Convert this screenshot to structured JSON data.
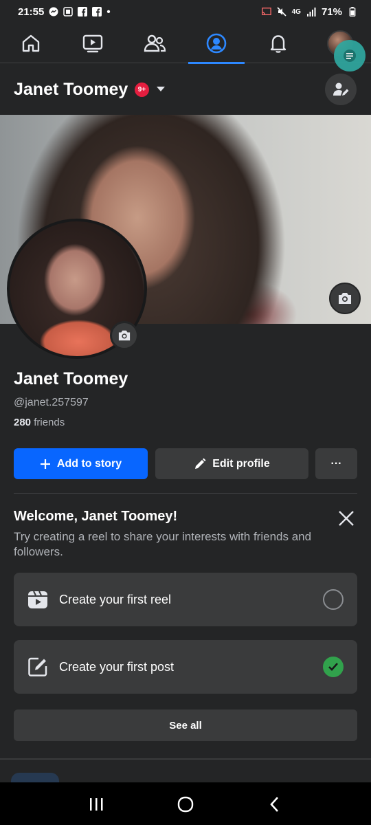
{
  "status_bar": {
    "time": "21:55",
    "dot": "•",
    "network": "4G",
    "battery": "71%"
  },
  "nav": {
    "tabs": [
      {
        "name": "home",
        "icon": "home-icon"
      },
      {
        "name": "video",
        "icon": "video-icon"
      },
      {
        "name": "friends",
        "icon": "friends-icon"
      },
      {
        "name": "profile",
        "icon": "profile-icon",
        "active": true
      },
      {
        "name": "notifications",
        "icon": "bell-icon"
      },
      {
        "name": "menu",
        "icon": "avatar"
      }
    ]
  },
  "header": {
    "name": "Janet Toomey",
    "badge": "9+"
  },
  "profile": {
    "name": "Janet Toomey",
    "handle": "@janet.257597",
    "friends_count": "280",
    "friends_label": "friends"
  },
  "buttons": {
    "add_story": "Add to story",
    "edit_profile": "Edit profile",
    "more": "···"
  },
  "welcome": {
    "title": "Welcome, Janet Toomey!",
    "subtitle": "Try creating a reel to share your interests with friends and followers."
  },
  "tasks": [
    {
      "label": "Create your first reel",
      "done": false
    },
    {
      "label": "Create your first post",
      "done": true
    }
  ],
  "see_all": "See all",
  "colors": {
    "accent": "#0866ff",
    "background": "#242526",
    "card": "#3a3b3c",
    "success": "#31a24c",
    "badge": "#e41e3f"
  }
}
